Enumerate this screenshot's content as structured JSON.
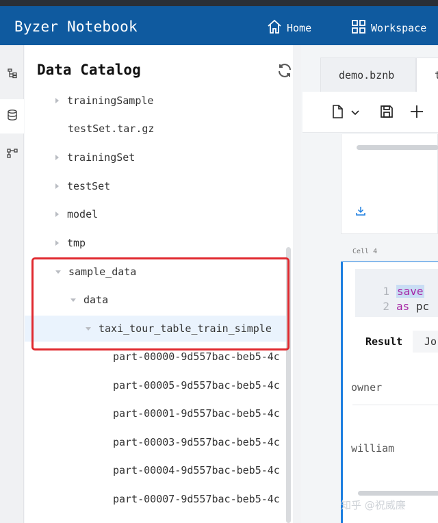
{
  "app": {
    "title": "Byzer Notebook"
  },
  "nav": {
    "home_label": "Home",
    "workspace_label": "Workspace"
  },
  "sidebar": {
    "icons": [
      "tree-structure-icon",
      "database-icon",
      "workflow-icon"
    ]
  },
  "catalog": {
    "title": "Data Catalog",
    "items": [
      {
        "label": "trainingSample",
        "caret": "right"
      },
      {
        "label": "testSet.tar.gz",
        "caret": "none"
      },
      {
        "label": "trainingSet",
        "caret": "right"
      },
      {
        "label": "testSet",
        "caret": "right"
      },
      {
        "label": "model",
        "caret": "right"
      },
      {
        "label": "tmp",
        "caret": "right"
      },
      {
        "label": "sample_data",
        "caret": "down"
      },
      {
        "label": "data",
        "caret": "down"
      },
      {
        "label": "taxi_tour_table_train_simple",
        "caret": "down",
        "selected": true
      },
      {
        "label": "part-00000-9d557bac-beb5-4c",
        "caret": "none"
      },
      {
        "label": "part-00005-9d557bac-beb5-4c",
        "caret": "none"
      },
      {
        "label": "part-00001-9d557bac-beb5-4c",
        "caret": "none"
      },
      {
        "label": "part-00003-9d557bac-beb5-4c",
        "caret": "none"
      },
      {
        "label": "part-00004-9d557bac-beb5-4c",
        "caret": "none"
      },
      {
        "label": "part-00007-9d557bac-beb5-4c",
        "caret": "none"
      }
    ]
  },
  "editor": {
    "tabs": [
      {
        "label": "demo.bznb",
        "active": false
      },
      {
        "label": "t",
        "active": true
      }
    ],
    "cell_label": "Cell 4",
    "code_lines": [
      {
        "num": "1",
        "keyword": "save"
      },
      {
        "num": "2",
        "keyword": "as",
        "rest": "pc"
      }
    ],
    "result_tabs": [
      {
        "label": "Result",
        "active": true
      },
      {
        "label": "Jo",
        "active": false
      }
    ],
    "result_header": "owner",
    "result_value": "william"
  },
  "watermark": "知乎 @祝威廉",
  "colors": {
    "header": "#0f5a9f",
    "accent": "#1d7fe0",
    "highlight": "#e0282e"
  }
}
